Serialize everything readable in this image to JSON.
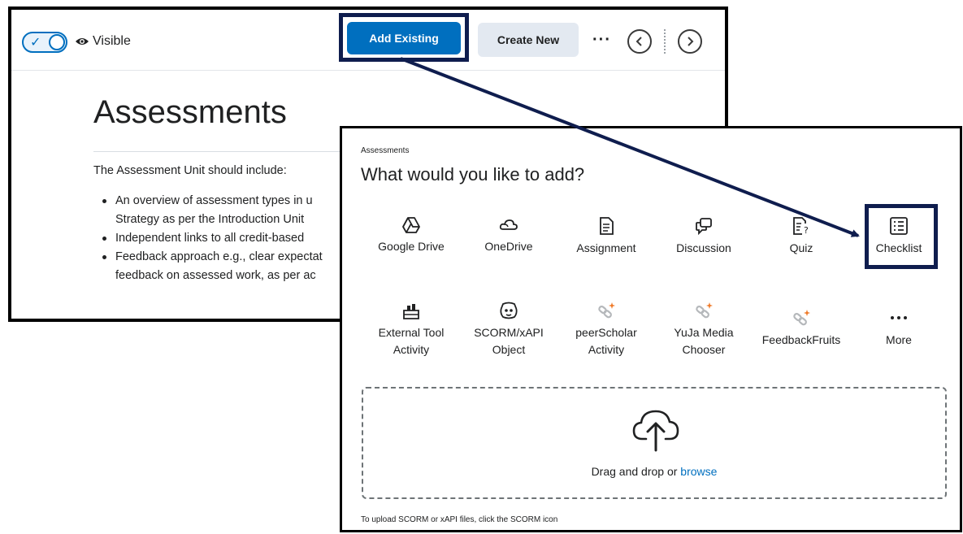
{
  "toolbar": {
    "visibility_label": "Visible",
    "add_existing_label": "Add Existing",
    "create_new_label": "Create New",
    "more_label": "···",
    "prev_icon": "chevron-left-icon",
    "next_icon": "chevron-right-icon"
  },
  "content": {
    "title": "Assessments",
    "intro": "The Assessment Unit should include:",
    "bullets": [
      "An overview of assessment types in u",
      "Strategy as per the Introduction Unit",
      "Independent links to all credit-based",
      "Feedback approach e.g., clear expectat",
      "feedback on assessed work, as per ac"
    ]
  },
  "dialog": {
    "breadcrumb": "Assessments",
    "heading": "What would you like to add?",
    "tiles_row1": [
      {
        "label": "Google Drive",
        "icon": "google-drive-icon"
      },
      {
        "label": "OneDrive",
        "icon": "onedrive-icon"
      },
      {
        "label": "Assignment",
        "icon": "assignment-icon"
      },
      {
        "label": "Discussion",
        "icon": "discussion-icon"
      },
      {
        "label": "Quiz",
        "icon": "quiz-icon"
      },
      {
        "label": "Checklist",
        "icon": "checklist-icon"
      }
    ],
    "tiles_row2": [
      {
        "label": "External Tool Activity",
        "line1": "External Tool",
        "line2": "Activity",
        "icon": "external-tool-icon"
      },
      {
        "label": "SCORM/xAPI Object",
        "line1": "SCORM/xAPI",
        "line2": "Object",
        "icon": "scorm-icon"
      },
      {
        "label": "peerScholar Activity",
        "line1": "peerScholar",
        "line2": "Activity",
        "icon": "lti-link-icon"
      },
      {
        "label": "YuJa Media Chooser",
        "line1": "YuJa Media",
        "line2": "Chooser",
        "icon": "lti-link-icon"
      },
      {
        "label": "FeedbackFruits",
        "icon": "lti-link-icon"
      },
      {
        "label": "More",
        "icon": "more-icon"
      }
    ],
    "dropzone": {
      "text": "Drag and drop or",
      "link": "browse",
      "icon": "cloud-upload-icon"
    },
    "footnote": "To upload SCORM or xAPI files, click the SCORM icon"
  },
  "colors": {
    "primary": "#006fbf",
    "highlight_frame": "#0f1d4e",
    "secondary_button": "#e3e9f1",
    "text": "#202122"
  }
}
